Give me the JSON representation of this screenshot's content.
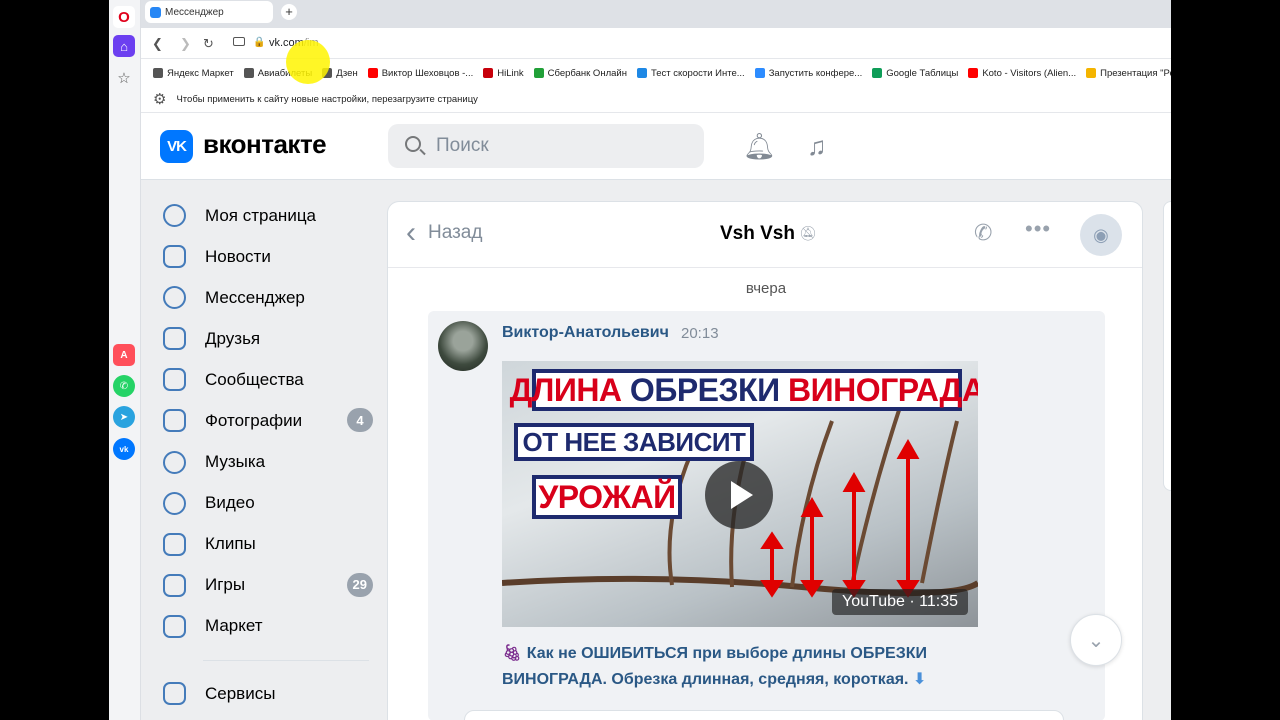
{
  "browser": {
    "tab_title": "Мессенджер",
    "new_tab": "+",
    "url_host": "vk.com",
    "url_path": "/im",
    "bookmarks": [
      {
        "label": "Яндекс Маркет",
        "color": "#555555"
      },
      {
        "label": "Авиабилеты",
        "color": "#555555"
      },
      {
        "label": "Дзен",
        "color": "#555555"
      },
      {
        "label": "Виктор Шеховцов -...",
        "color": "#ff0000"
      },
      {
        "label": "HiLink",
        "color": "#c7000b"
      },
      {
        "label": "Сбербанк Онлайн",
        "color": "#21a038"
      },
      {
        "label": "Тест скорости Инте...",
        "color": "#1e88e5"
      },
      {
        "label": "Запустить конфере...",
        "color": "#2d8cff"
      },
      {
        "label": "Google Таблицы",
        "color": "#0f9d58"
      },
      {
        "label": "Koto - Visitors (Alien...",
        "color": "#ff0000"
      },
      {
        "label": "Презентация \"Ре...",
        "color": "#f4b400"
      }
    ],
    "infobar_text": "Чтобы применить к сайту новые настройки, перезагрузите страницу"
  },
  "vk": {
    "brand": "вконтакте",
    "logo_text": "VK",
    "search_placeholder": "Поиск",
    "nav": [
      {
        "label": "Моя страница",
        "icon": "profile-icon"
      },
      {
        "label": "Новости",
        "icon": "news-icon"
      },
      {
        "label": "Мессенджер",
        "icon": "messenger-icon"
      },
      {
        "label": "Друзья",
        "icon": "friends-icon"
      },
      {
        "label": "Сообщества",
        "icon": "communities-icon"
      },
      {
        "label": "Фотографии",
        "icon": "photos-icon",
        "badge": "4"
      },
      {
        "label": "Музыка",
        "icon": "music-icon"
      },
      {
        "label": "Видео",
        "icon": "video-icon"
      },
      {
        "label": "Клипы",
        "icon": "clips-icon"
      },
      {
        "label": "Игры",
        "icon": "games-icon",
        "badge": "29"
      },
      {
        "label": "Маркет",
        "icon": "market-icon"
      }
    ],
    "services_label": "Сервисы",
    "chat": {
      "back_label": "Назад",
      "title": "Vsh Vsh",
      "date_separator": "вчера",
      "message": {
        "author": "Виктор-Анатольевич",
        "time": "20:13",
        "video": {
          "banner_1": "ДЛИНА ОБРЕЗКИ ВИНОГРАДА",
          "banner_1_word_red": "ДЛИНА",
          "banner_1_word_dark": "ОБРЕЗКИ",
          "banner_1_word_red2": "ВИНОГРАДА",
          "banner_2": "ОТ НЕЕ ЗАВИСИТ",
          "banner_3": "УРОЖАЙ",
          "source_duration": "YouTube · 11:35"
        },
        "text": "Как не ОШИБИТЬСЯ при выборе длины ОБРЕЗКИ ВИНОГРАДА. Обрезка длинная, средняя, короткая."
      }
    }
  },
  "colors": {
    "vk_blue": "#0077ff",
    "link": "#2a5885",
    "icon_blue": "#447bba"
  }
}
